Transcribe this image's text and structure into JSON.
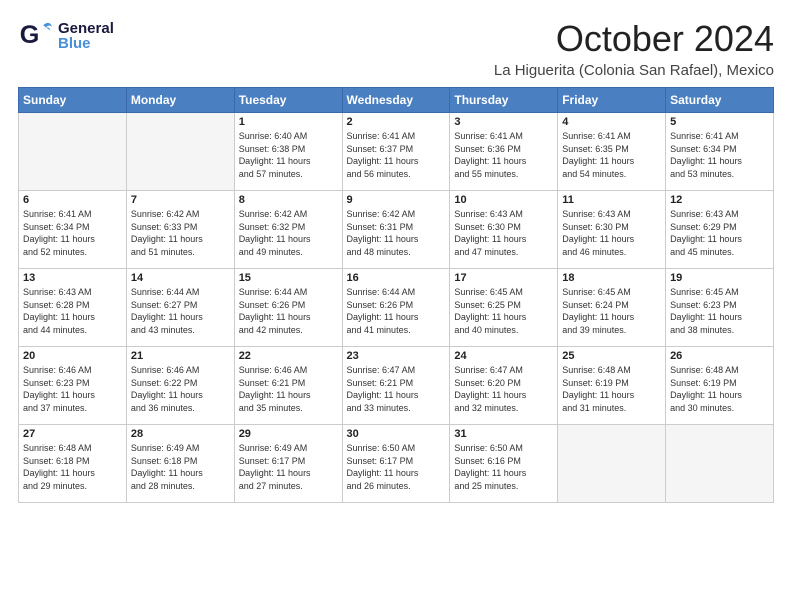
{
  "header": {
    "logo": {
      "general": "General",
      "blue": "Blue"
    },
    "month_title": "October 2024",
    "location": "La Higuerita (Colonia San Rafael), Mexico"
  },
  "calendar": {
    "headers": [
      "Sunday",
      "Monday",
      "Tuesday",
      "Wednesday",
      "Thursday",
      "Friday",
      "Saturday"
    ],
    "weeks": [
      [
        {
          "day": "",
          "lines": []
        },
        {
          "day": "",
          "lines": []
        },
        {
          "day": "1",
          "lines": [
            "Sunrise: 6:40 AM",
            "Sunset: 6:38 PM",
            "Daylight: 11 hours",
            "and 57 minutes."
          ]
        },
        {
          "day": "2",
          "lines": [
            "Sunrise: 6:41 AM",
            "Sunset: 6:37 PM",
            "Daylight: 11 hours",
            "and 56 minutes."
          ]
        },
        {
          "day": "3",
          "lines": [
            "Sunrise: 6:41 AM",
            "Sunset: 6:36 PM",
            "Daylight: 11 hours",
            "and 55 minutes."
          ]
        },
        {
          "day": "4",
          "lines": [
            "Sunrise: 6:41 AM",
            "Sunset: 6:35 PM",
            "Daylight: 11 hours",
            "and 54 minutes."
          ]
        },
        {
          "day": "5",
          "lines": [
            "Sunrise: 6:41 AM",
            "Sunset: 6:34 PM",
            "Daylight: 11 hours",
            "and 53 minutes."
          ]
        }
      ],
      [
        {
          "day": "6",
          "lines": [
            "Sunrise: 6:41 AM",
            "Sunset: 6:34 PM",
            "Daylight: 11 hours",
            "and 52 minutes."
          ]
        },
        {
          "day": "7",
          "lines": [
            "Sunrise: 6:42 AM",
            "Sunset: 6:33 PM",
            "Daylight: 11 hours",
            "and 51 minutes."
          ]
        },
        {
          "day": "8",
          "lines": [
            "Sunrise: 6:42 AM",
            "Sunset: 6:32 PM",
            "Daylight: 11 hours",
            "and 49 minutes."
          ]
        },
        {
          "day": "9",
          "lines": [
            "Sunrise: 6:42 AM",
            "Sunset: 6:31 PM",
            "Daylight: 11 hours",
            "and 48 minutes."
          ]
        },
        {
          "day": "10",
          "lines": [
            "Sunrise: 6:43 AM",
            "Sunset: 6:30 PM",
            "Daylight: 11 hours",
            "and 47 minutes."
          ]
        },
        {
          "day": "11",
          "lines": [
            "Sunrise: 6:43 AM",
            "Sunset: 6:30 PM",
            "Daylight: 11 hours",
            "and 46 minutes."
          ]
        },
        {
          "day": "12",
          "lines": [
            "Sunrise: 6:43 AM",
            "Sunset: 6:29 PM",
            "Daylight: 11 hours",
            "and 45 minutes."
          ]
        }
      ],
      [
        {
          "day": "13",
          "lines": [
            "Sunrise: 6:43 AM",
            "Sunset: 6:28 PM",
            "Daylight: 11 hours",
            "and 44 minutes."
          ]
        },
        {
          "day": "14",
          "lines": [
            "Sunrise: 6:44 AM",
            "Sunset: 6:27 PM",
            "Daylight: 11 hours",
            "and 43 minutes."
          ]
        },
        {
          "day": "15",
          "lines": [
            "Sunrise: 6:44 AM",
            "Sunset: 6:26 PM",
            "Daylight: 11 hours",
            "and 42 minutes."
          ]
        },
        {
          "day": "16",
          "lines": [
            "Sunrise: 6:44 AM",
            "Sunset: 6:26 PM",
            "Daylight: 11 hours",
            "and 41 minutes."
          ]
        },
        {
          "day": "17",
          "lines": [
            "Sunrise: 6:45 AM",
            "Sunset: 6:25 PM",
            "Daylight: 11 hours",
            "and 40 minutes."
          ]
        },
        {
          "day": "18",
          "lines": [
            "Sunrise: 6:45 AM",
            "Sunset: 6:24 PM",
            "Daylight: 11 hours",
            "and 39 minutes."
          ]
        },
        {
          "day": "19",
          "lines": [
            "Sunrise: 6:45 AM",
            "Sunset: 6:23 PM",
            "Daylight: 11 hours",
            "and 38 minutes."
          ]
        }
      ],
      [
        {
          "day": "20",
          "lines": [
            "Sunrise: 6:46 AM",
            "Sunset: 6:23 PM",
            "Daylight: 11 hours",
            "and 37 minutes."
          ]
        },
        {
          "day": "21",
          "lines": [
            "Sunrise: 6:46 AM",
            "Sunset: 6:22 PM",
            "Daylight: 11 hours",
            "and 36 minutes."
          ]
        },
        {
          "day": "22",
          "lines": [
            "Sunrise: 6:46 AM",
            "Sunset: 6:21 PM",
            "Daylight: 11 hours",
            "and 35 minutes."
          ]
        },
        {
          "day": "23",
          "lines": [
            "Sunrise: 6:47 AM",
            "Sunset: 6:21 PM",
            "Daylight: 11 hours",
            "and 33 minutes."
          ]
        },
        {
          "day": "24",
          "lines": [
            "Sunrise: 6:47 AM",
            "Sunset: 6:20 PM",
            "Daylight: 11 hours",
            "and 32 minutes."
          ]
        },
        {
          "day": "25",
          "lines": [
            "Sunrise: 6:48 AM",
            "Sunset: 6:19 PM",
            "Daylight: 11 hours",
            "and 31 minutes."
          ]
        },
        {
          "day": "26",
          "lines": [
            "Sunrise: 6:48 AM",
            "Sunset: 6:19 PM",
            "Daylight: 11 hours",
            "and 30 minutes."
          ]
        }
      ],
      [
        {
          "day": "27",
          "lines": [
            "Sunrise: 6:48 AM",
            "Sunset: 6:18 PM",
            "Daylight: 11 hours",
            "and 29 minutes."
          ]
        },
        {
          "day": "28",
          "lines": [
            "Sunrise: 6:49 AM",
            "Sunset: 6:18 PM",
            "Daylight: 11 hours",
            "and 28 minutes."
          ]
        },
        {
          "day": "29",
          "lines": [
            "Sunrise: 6:49 AM",
            "Sunset: 6:17 PM",
            "Daylight: 11 hours",
            "and 27 minutes."
          ]
        },
        {
          "day": "30",
          "lines": [
            "Sunrise: 6:50 AM",
            "Sunset: 6:17 PM",
            "Daylight: 11 hours",
            "and 26 minutes."
          ]
        },
        {
          "day": "31",
          "lines": [
            "Sunrise: 6:50 AM",
            "Sunset: 6:16 PM",
            "Daylight: 11 hours",
            "and 25 minutes."
          ]
        },
        {
          "day": "",
          "lines": []
        },
        {
          "day": "",
          "lines": []
        }
      ]
    ]
  }
}
